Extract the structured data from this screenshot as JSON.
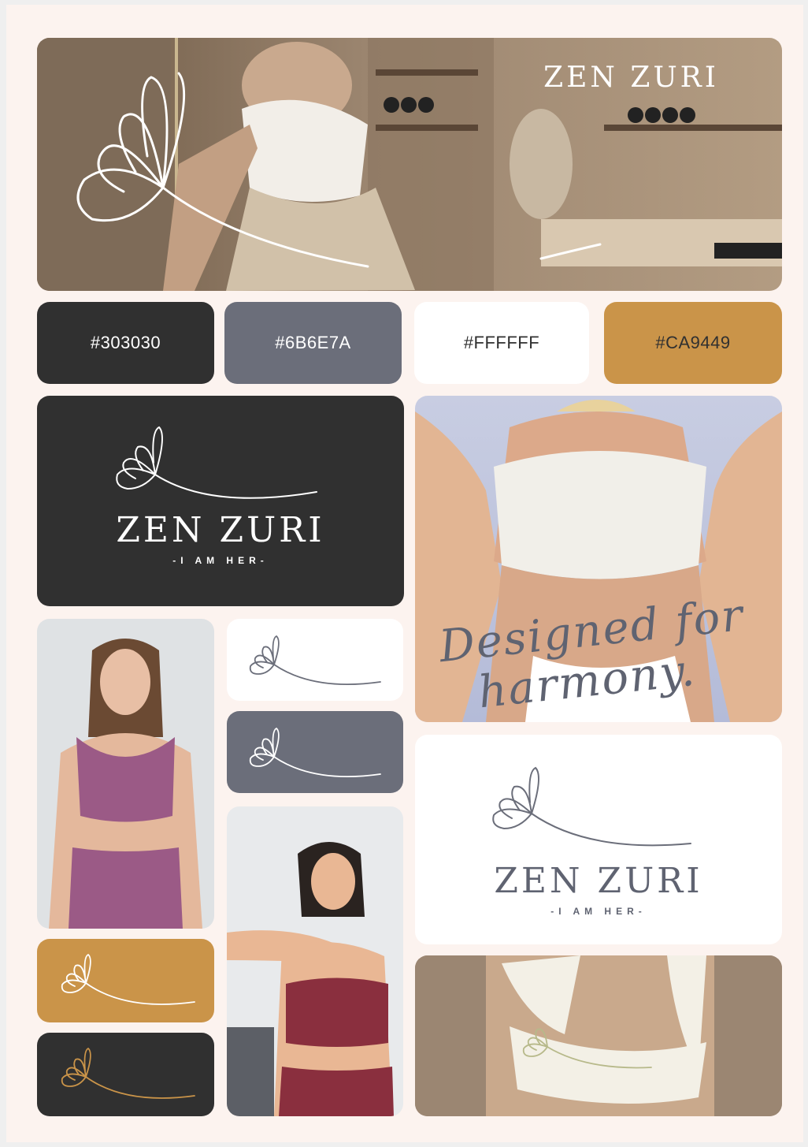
{
  "brand": {
    "name": "ZEN ZURI",
    "tagline": "-I AM HER-",
    "slogan_line1": "Designed for",
    "slogan_line2": "harmony."
  },
  "palette": [
    {
      "label": "#303030",
      "color": "#303030",
      "text_color": "#ffffff"
    },
    {
      "label": "#6B6E7A",
      "color": "#6B6E7A",
      "text_color": "#ffffff"
    },
    {
      "label": "#FFFFFF",
      "color": "#FFFFFF",
      "text_color": "#303030"
    },
    {
      "label": "#CA9449",
      "color": "#CA9449",
      "text_color": "#303030"
    }
  ],
  "colors": {
    "page_background": "#fcf3ef",
    "dark": "#303030",
    "slate": "#6B6E7A",
    "white": "#FFFFFF",
    "gold": "#CA9449"
  },
  "icons": [
    "flower-logo-icon"
  ]
}
